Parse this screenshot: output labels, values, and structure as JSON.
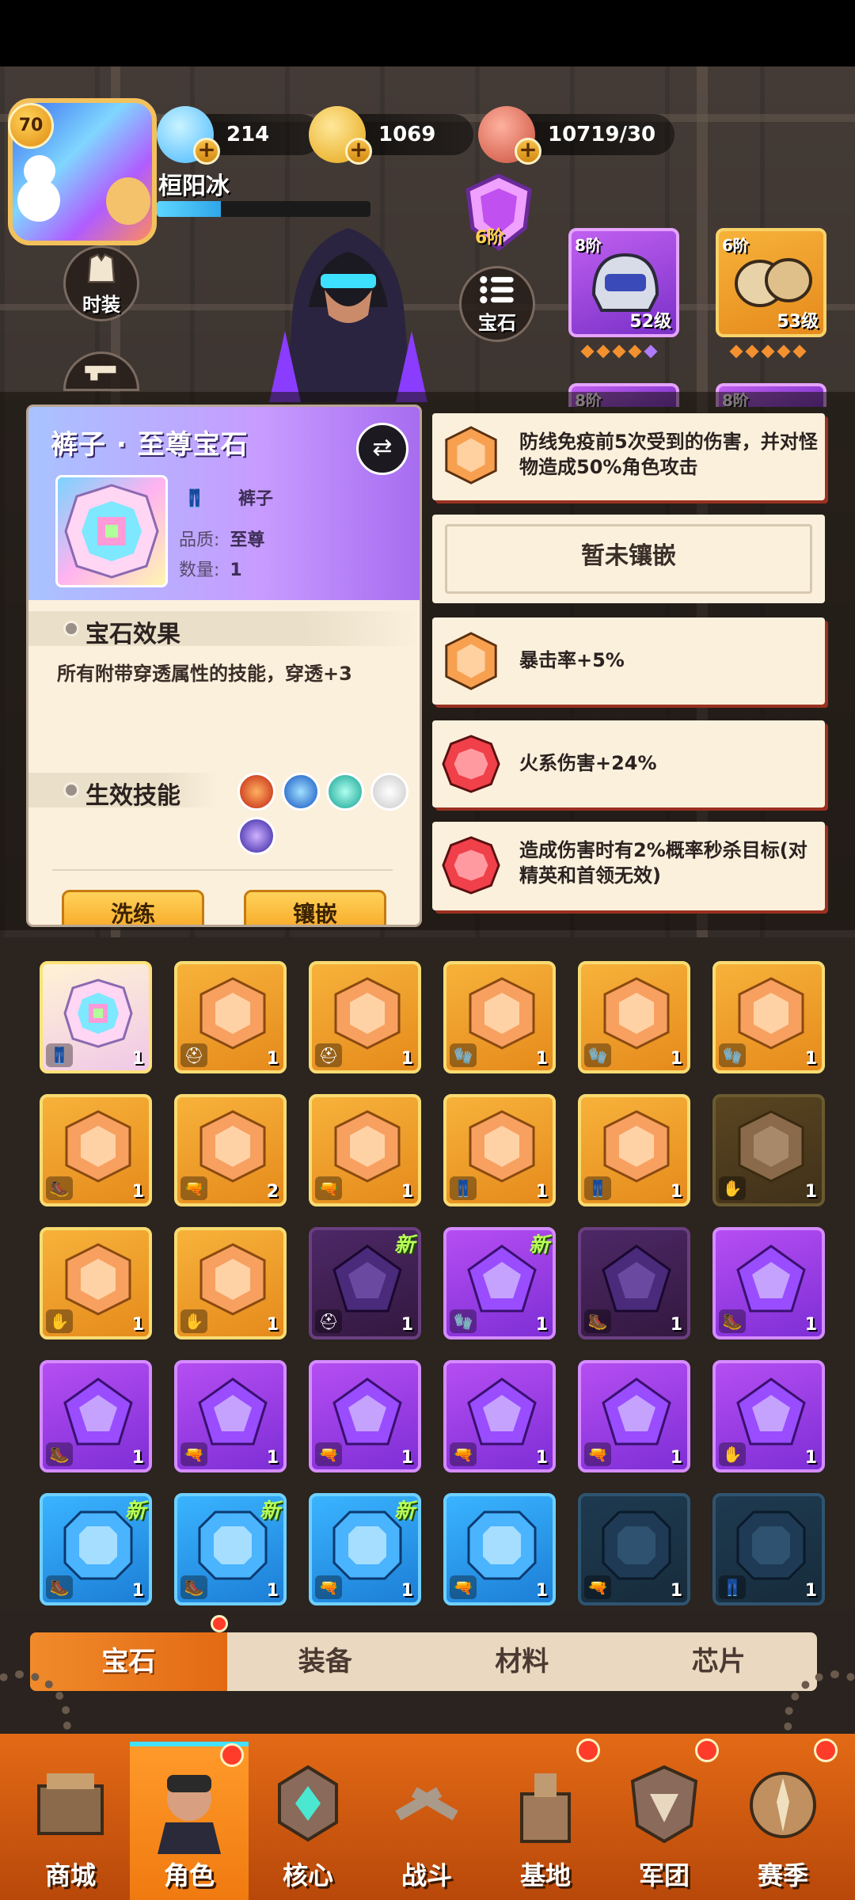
{
  "resources": {
    "gems": "214",
    "coins": "1069",
    "stamina": "10719/30"
  },
  "player": {
    "level": "70",
    "name": "桓阳冰",
    "xp_fraction": 0.3
  },
  "side_buttons": {
    "costume": "时装",
    "gem": "宝石"
  },
  "rank_badge": "6阶",
  "equipment": [
    {
      "tier": "8阶",
      "level": "52级",
      "pips": 5
    },
    {
      "tier": "6阶",
      "level": "53级",
      "pips": 5
    },
    {
      "tier": "8阶",
      "level": "",
      "pips": 0
    },
    {
      "tier": "8阶",
      "level": "",
      "pips": 0
    }
  ],
  "popup": {
    "title": "裤子 · 至尊宝石",
    "slot_label": "裤子",
    "quality_label": "品质:",
    "quality_value": "至尊",
    "quantity_label": "数量:",
    "quantity_value": "1",
    "effect_header": "宝石效果",
    "effect_desc": "所有附带穿透属性的技能，穿透+3",
    "skills_header": "生效技能",
    "refine_button": "洗练",
    "inlay_button": "镶嵌"
  },
  "sockets": [
    {
      "text": "防线免疫前5次受到的伤害，并对怪物造成50%角色攻击",
      "color": "orange"
    },
    {
      "text": "暂未镶嵌",
      "color": "empty"
    },
    {
      "text": "暴击率+5%",
      "color": "orange"
    },
    {
      "text": "火系伤害+24%",
      "color": "red"
    },
    {
      "text": "造成伤害时有2%概率秒杀目标(对精英和首领无效)",
      "color": "red"
    }
  ],
  "inventory": {
    "new_label": "新",
    "rows": [
      [
        {
          "c": "rainbow",
          "n": "1",
          "t": "pants",
          "new": false
        },
        {
          "c": "orange",
          "n": "1",
          "t": "helmet",
          "new": false
        },
        {
          "c": "orange",
          "n": "1",
          "t": "helmet",
          "new": false
        },
        {
          "c": "orange",
          "n": "1",
          "t": "glove",
          "new": false
        },
        {
          "c": "orange",
          "n": "1",
          "t": "glove",
          "new": false
        },
        {
          "c": "orange",
          "n": "1",
          "t": "glove",
          "new": false
        }
      ],
      [
        {
          "c": "orange",
          "n": "1",
          "t": "boot",
          "new": false
        },
        {
          "c": "orange",
          "n": "2",
          "t": "gun",
          "new": false
        },
        {
          "c": "orange",
          "n": "1",
          "t": "gun",
          "new": false
        },
        {
          "c": "orange",
          "n": "1",
          "t": "pants",
          "new": false
        },
        {
          "c": "orange",
          "n": "1",
          "t": "pants",
          "new": false
        },
        {
          "c": "orange-dim",
          "n": "1",
          "t": "hand",
          "new": false
        }
      ],
      [
        {
          "c": "orange",
          "n": "1",
          "t": "hand",
          "new": false
        },
        {
          "c": "orange",
          "n": "1",
          "t": "hand",
          "new": false
        },
        {
          "c": "purple-dim",
          "n": "1",
          "t": "helmet",
          "new": true
        },
        {
          "c": "purple",
          "n": "1",
          "t": "glove",
          "new": true
        },
        {
          "c": "purple-dim",
          "n": "1",
          "t": "boot",
          "new": false
        },
        {
          "c": "purple",
          "n": "1",
          "t": "boot",
          "new": false
        }
      ],
      [
        {
          "c": "purple",
          "n": "1",
          "t": "boot",
          "new": false
        },
        {
          "c": "purple",
          "n": "1",
          "t": "gun",
          "new": false
        },
        {
          "c": "purple",
          "n": "1",
          "t": "gun",
          "new": false
        },
        {
          "c": "purple",
          "n": "1",
          "t": "gun",
          "new": false
        },
        {
          "c": "purple",
          "n": "1",
          "t": "gun",
          "new": false
        },
        {
          "c": "purple",
          "n": "1",
          "t": "hand",
          "new": false
        }
      ],
      [
        {
          "c": "blue",
          "n": "1",
          "t": "boot",
          "new": true
        },
        {
          "c": "blue",
          "n": "1",
          "t": "boot",
          "new": true
        },
        {
          "c": "blue",
          "n": "1",
          "t": "gun",
          "new": true
        },
        {
          "c": "blue",
          "n": "1",
          "t": "gun",
          "new": false
        },
        {
          "c": "blue-dim",
          "n": "1",
          "t": "gun",
          "new": false
        },
        {
          "c": "blue-dim",
          "n": "1",
          "t": "pants",
          "new": false
        }
      ]
    ]
  },
  "tabs": [
    "宝石",
    "装备",
    "材料",
    "芯片"
  ],
  "nav": [
    {
      "label": "商城",
      "alert": false
    },
    {
      "label": "角色",
      "alert": true
    },
    {
      "label": "核心",
      "alert": false
    },
    {
      "label": "战斗",
      "alert": false
    },
    {
      "label": "基地",
      "alert": true
    },
    {
      "label": "军团",
      "alert": true
    },
    {
      "label": "赛季",
      "alert": true
    }
  ],
  "colors": {
    "accent_orange": "#f08a2a",
    "gold_frame": "#f4d86a",
    "purple_frame": "#d58cff",
    "blue_frame": "#6fd0ff",
    "panel_bg": "#fbf0dc"
  }
}
